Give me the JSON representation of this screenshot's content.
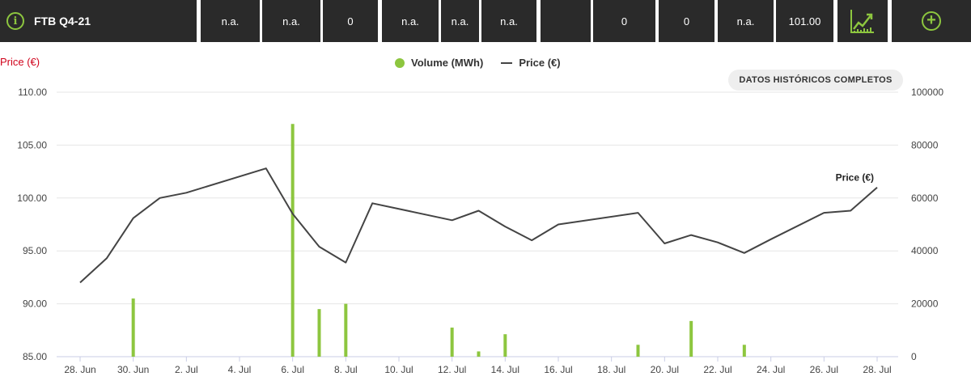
{
  "header": {
    "contract": "FTB Q4-21",
    "cells": [
      "n.a.",
      "n.a.",
      "0",
      "n.a.",
      "n.a.",
      "n.a.",
      "",
      "0",
      "0",
      "n.a.",
      "101.00"
    ]
  },
  "history_button": "DATOS HISTÓRICOS COMPLETOS",
  "chart_data": {
    "type": "bar+line",
    "yleft_title": "Price (€)",
    "legend": [
      {
        "name": "Volume (MWh)",
        "color": "#8dc63f",
        "type": "bar"
      },
      {
        "name": "Price (€)",
        "color": "#444444",
        "type": "line"
      }
    ],
    "series_label": "Price (€)",
    "x_tick_labels": [
      "28. Jun",
      "30. Jun",
      "2. Jul",
      "4. Jul",
      "6. Jul",
      "8. Jul",
      "10. Jul",
      "12. Jul",
      "14. Jul",
      "16. Jul",
      "18. Jul",
      "20. Jul",
      "22. Jul",
      "24. Jul",
      "26. Jul",
      "28. Jul"
    ],
    "x_range": [
      0,
      30
    ],
    "yleft_range": [
      85,
      110
    ],
    "yleft_ticks": [
      "85.00",
      "90.00",
      "95.00",
      "100.00",
      "105.00",
      "110.00"
    ],
    "yright_range": [
      0,
      100000
    ],
    "yright_ticks": [
      "0",
      "20000",
      "40000",
      "60000",
      "80000",
      "100000"
    ],
    "price_x": [
      0,
      1,
      2,
      3,
      4,
      7,
      8,
      9,
      10,
      11,
      14,
      15,
      16,
      17,
      18,
      21,
      22,
      23,
      24,
      25,
      26,
      28,
      29,
      30
    ],
    "price_y": [
      92.0,
      94.3,
      98.1,
      100.0,
      100.5,
      102.8,
      98.5,
      95.4,
      93.9,
      99.5,
      97.9,
      98.8,
      97.3,
      96.0,
      97.5,
      98.6,
      95.7,
      96.5,
      95.8,
      94.8,
      96.1,
      98.6,
      98.8,
      101.0
    ],
    "volume_x": [
      2,
      8,
      9,
      10,
      14,
      15,
      16,
      21,
      23,
      25
    ],
    "volume_y": [
      22000,
      88000,
      18000,
      20000,
      11000,
      2000,
      8500,
      4500,
      13500,
      4500
    ]
  }
}
